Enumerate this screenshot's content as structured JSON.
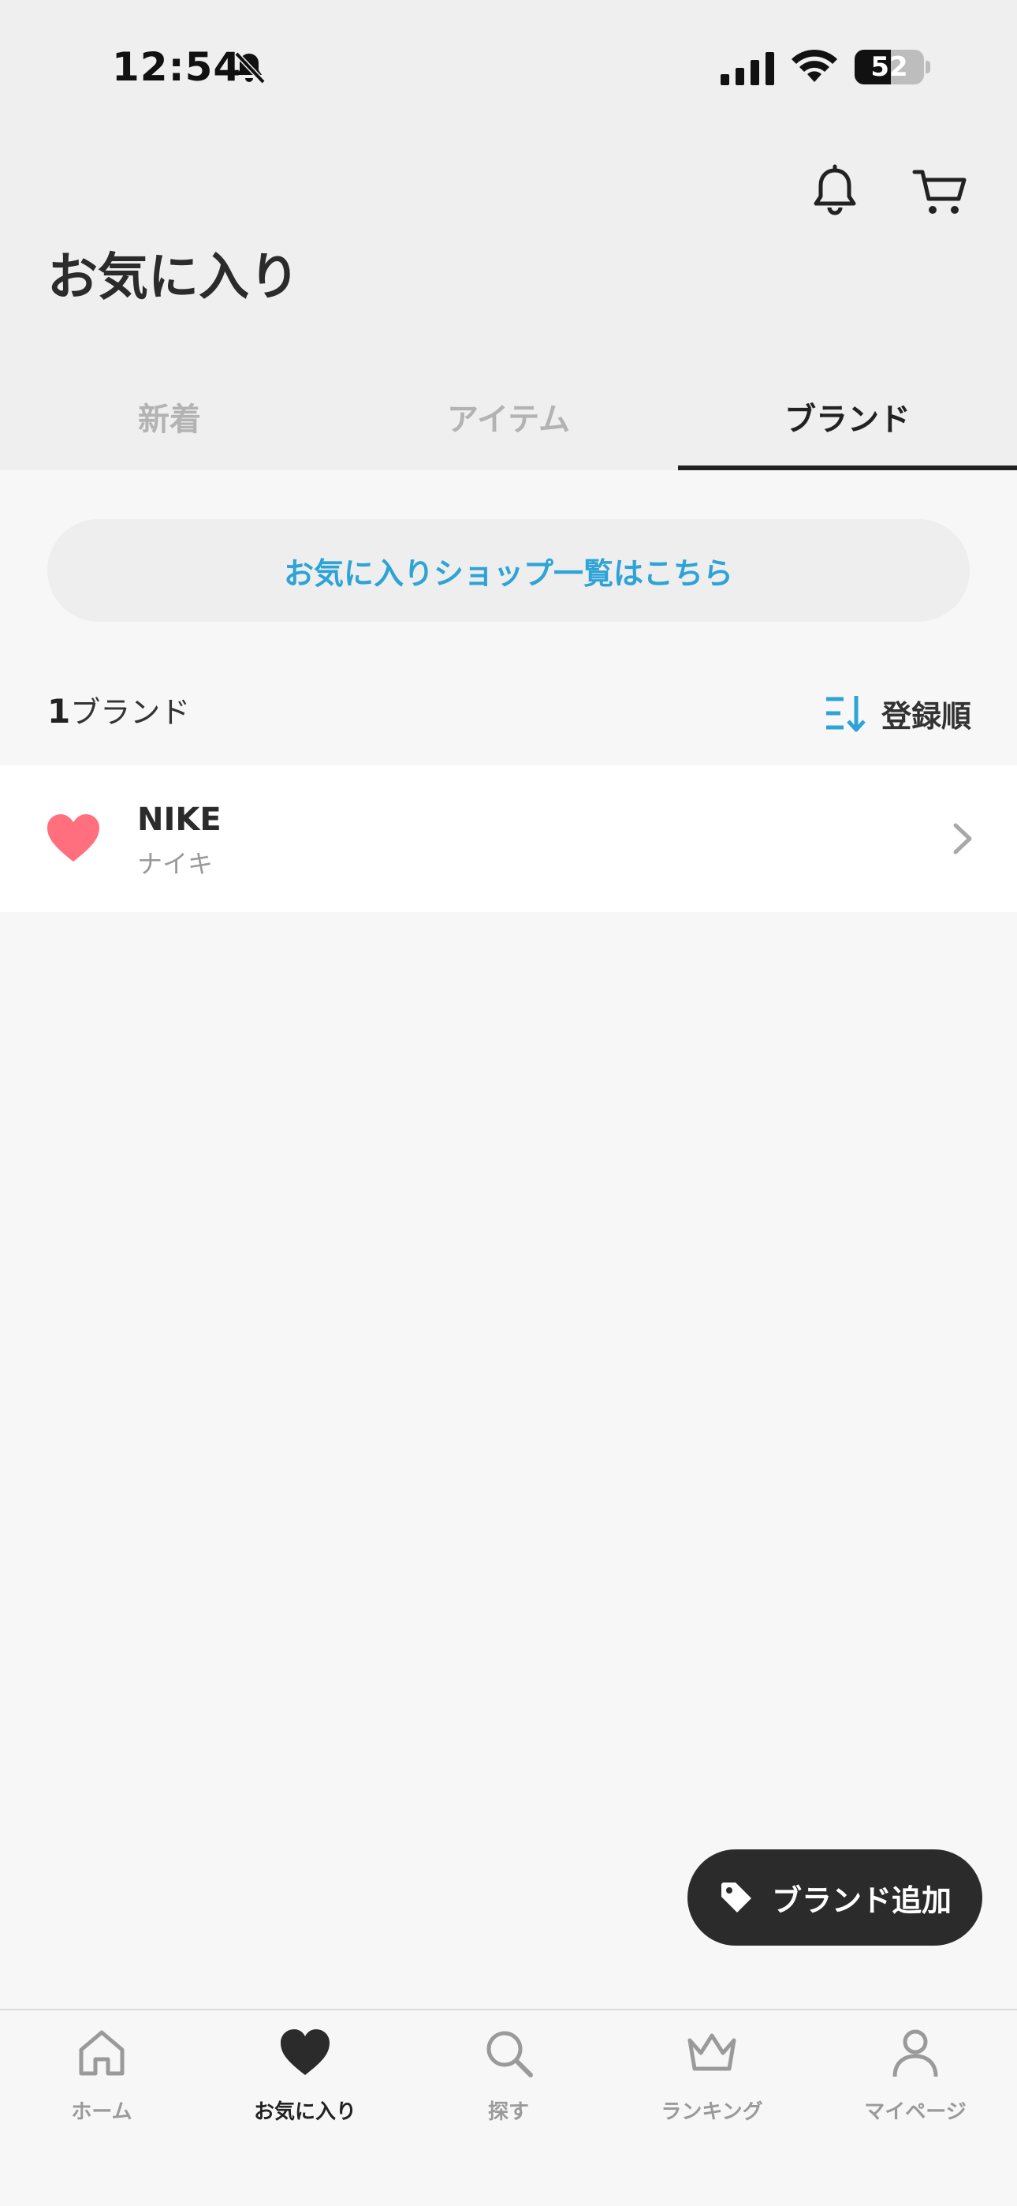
{
  "status_bar": {
    "time": "12:54",
    "battery_level": 52,
    "battery_text": "52"
  },
  "header": {
    "title": "お気に入り",
    "icons": [
      "bell-icon",
      "cart-icon"
    ]
  },
  "tabs": [
    {
      "label": "新着",
      "active": false
    },
    {
      "label": "アイテム",
      "active": false
    },
    {
      "label": "ブランド",
      "active": true
    }
  ],
  "shop_link": {
    "label": "お気に入りショップ一覧はこちら"
  },
  "list_header": {
    "count": "1",
    "count_suffix": "ブランド",
    "sort_label": "登録順"
  },
  "brands": [
    {
      "name": "NIKE",
      "kana": "ナイキ",
      "favorited": true
    }
  ],
  "fab": {
    "label": "ブランド追加"
  },
  "bottom_nav": [
    {
      "label": "ホーム",
      "icon": "home-icon",
      "active": false
    },
    {
      "label": "お気に入り",
      "icon": "heart-icon",
      "active": true
    },
    {
      "label": "探す",
      "icon": "search-icon",
      "active": false
    },
    {
      "label": "ランキング",
      "icon": "crown-icon",
      "active": false
    },
    {
      "label": "マイページ",
      "icon": "person-icon",
      "active": false
    }
  ],
  "colors": {
    "accent": "#2ea3d6",
    "heart": "#ff6f7d",
    "dark": "#2b2b2b"
  }
}
